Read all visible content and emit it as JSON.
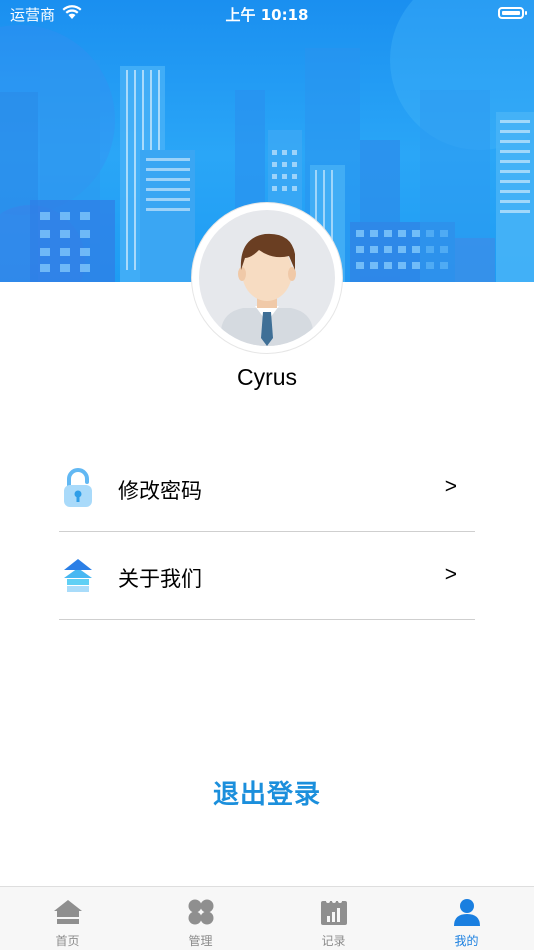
{
  "status_bar": {
    "carrier": "运营商",
    "time": "上午 10:18"
  },
  "profile": {
    "username": "Cyrus"
  },
  "menu": [
    {
      "label": "修改密码",
      "icon": "lock-icon",
      "arrow": ">"
    },
    {
      "label": "关于我们",
      "icon": "stack-arrow-icon",
      "arrow": ">"
    }
  ],
  "logout_label": "退出登录",
  "tabs": [
    {
      "label": "首页",
      "icon": "home-icon",
      "active": false
    },
    {
      "label": "管理",
      "icon": "grid-icon",
      "active": false
    },
    {
      "label": "记录",
      "icon": "record-icon",
      "active": false
    },
    {
      "label": "我的",
      "icon": "person-icon",
      "active": true
    }
  ],
  "colors": {
    "header_blue": "#1e9cf3",
    "accent": "#1b8fdc",
    "tab_active": "#1a7fe0",
    "tab_inactive": "#8c8c8c"
  }
}
